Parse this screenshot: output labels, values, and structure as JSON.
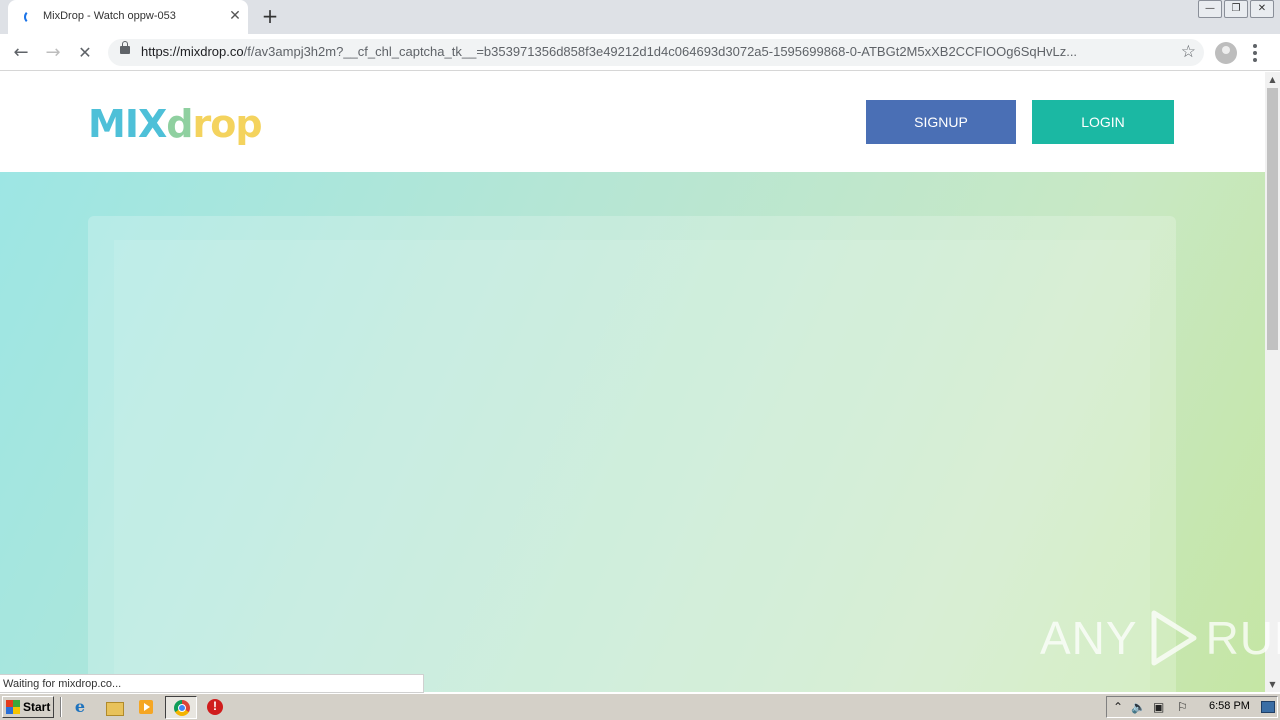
{
  "browser": {
    "tab": {
      "title": "MixDrop - Watch oppw-053",
      "close_glyph": "✕"
    },
    "new_tab_glyph": "+",
    "window_controls": [
      "—",
      "❐",
      "✕"
    ],
    "nav": {
      "back_glyph": "←",
      "forward_glyph": "→",
      "reload_glyph": "✕"
    },
    "url": {
      "scheme": "https://",
      "domain": "mixdrop.co",
      "path": "/f/av3ampj3h2m?__cf_chl_captcha_tk__=b353971356d858f3e49212d1d4c064693d3072a5-1595699868-0-ATBGt2M5xXB2CCFIOOg6SqHvLz..."
    },
    "star_glyph": "☆",
    "status_text": "Waiting for mixdrop.co..."
  },
  "site": {
    "logo": {
      "part1": "MIX",
      "part2": "d",
      "part3": "rop"
    },
    "signup_label": "SIGNUP",
    "login_label": "LOGIN",
    "colors": {
      "signup": "#4a6fb5",
      "login": "#1bb8a3"
    }
  },
  "watermark": {
    "left": "ANY",
    "right": "RUN"
  },
  "taskbar": {
    "start_label": "Start",
    "ie_glyph": "e",
    "clock": "6:58 PM",
    "tray_icons": [
      "⌃",
      "🔈",
      "▣",
      "⚐"
    ]
  }
}
